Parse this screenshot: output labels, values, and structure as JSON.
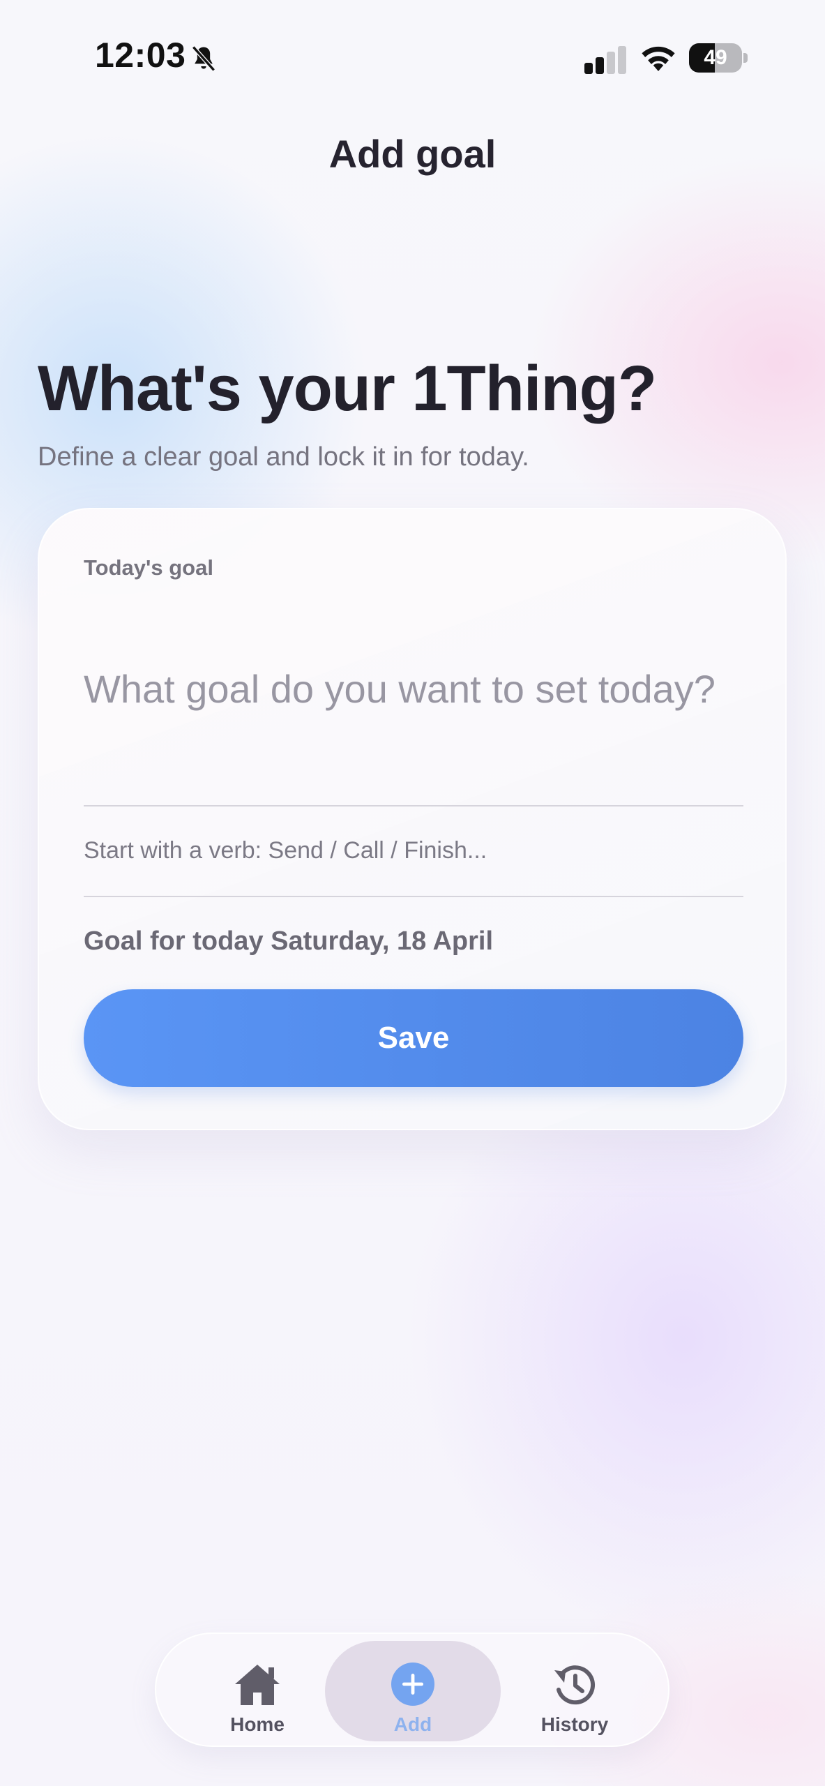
{
  "status_bar": {
    "time": "12:03",
    "battery": "49",
    "battery_level": 0.49
  },
  "header": {
    "title": "Add goal"
  },
  "hero": {
    "title": "What's your 1Thing?",
    "subtitle": "Define a clear goal and lock it in for today."
  },
  "goal_form": {
    "label": "Today's goal",
    "input_value": "",
    "input_placeholder": "What goal do you want to set today?",
    "hint": "Start with a verb: Send / Call / Finish...",
    "date_text": "Goal for today Saturday, 18 April",
    "save_label": "Save"
  },
  "tab_bar": {
    "items": [
      {
        "label": "Home",
        "icon": "home-icon"
      },
      {
        "label": "Add",
        "icon": "plus-circle-icon",
        "selected": true
      },
      {
        "label": "History",
        "icon": "history-icon"
      }
    ]
  },
  "colors": {
    "accent": "#5a95f5",
    "accent_light": "#8eb2ee"
  }
}
